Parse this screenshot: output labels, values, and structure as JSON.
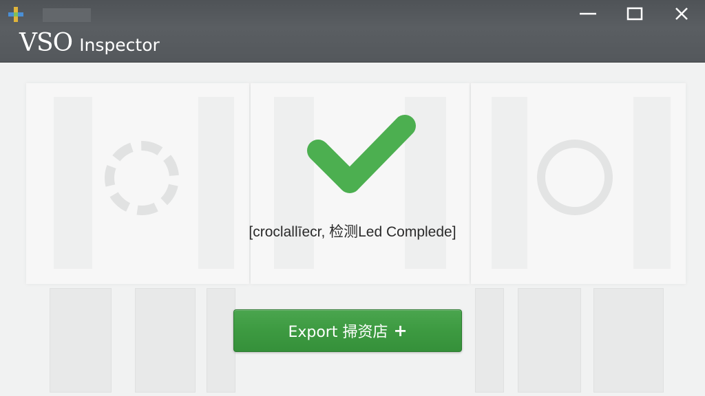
{
  "window": {
    "app_brand": "VSO",
    "app_name": "Inspector",
    "icons": {
      "app": "plus-app-icon",
      "minimize": "minimize-icon",
      "maximize": "maximize-icon",
      "close": "close-icon",
      "status": "checkmark-icon"
    }
  },
  "main": {
    "status_text": "[croclallīecr, 检测Led Complede]",
    "export_label": "Export 掃资店",
    "export_icon": "+"
  },
  "colors": {
    "titlebar": "#54585c",
    "accent_green": "#3d9a41",
    "check_green": "#4caf50"
  }
}
